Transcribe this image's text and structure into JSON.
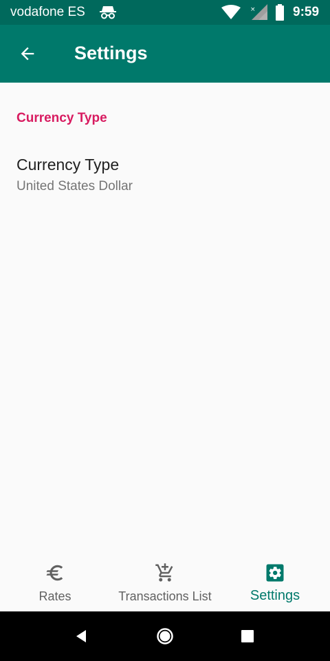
{
  "status_bar": {
    "carrier": "vodafone ES",
    "time": "9:59"
  },
  "toolbar": {
    "title": "Settings",
    "back_icon": "arrow-back-icon"
  },
  "preferences": {
    "category": "Currency Type",
    "item": {
      "title": "Currency Type",
      "summary": "United States Dollar"
    }
  },
  "bottom_nav": {
    "items": [
      {
        "label": "Rates",
        "icon": "euro-icon",
        "active": false
      },
      {
        "label": "Transactions List",
        "icon": "cart-add-icon",
        "active": false
      },
      {
        "label": "Settings",
        "icon": "settings-gear-icon",
        "active": true
      }
    ]
  },
  "colors": {
    "status_bar": "#00695c",
    "toolbar": "#00796b",
    "accent": "#d81b60",
    "nav_active": "#00796b",
    "nav_inactive": "#616161"
  }
}
